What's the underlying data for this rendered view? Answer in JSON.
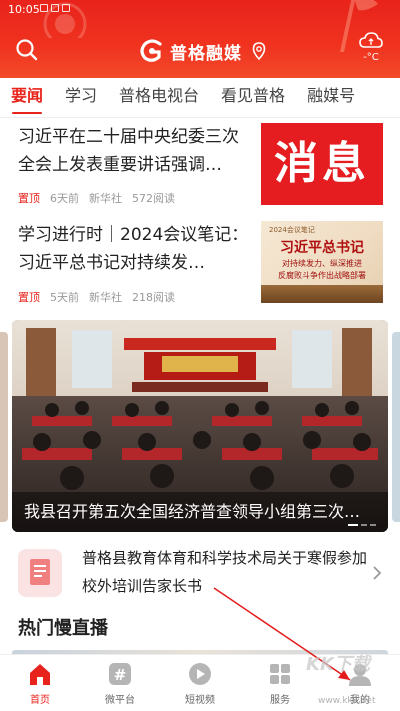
{
  "status_bar": {
    "time": "10:05"
  },
  "header": {
    "brand": "普格融媒",
    "temperature": "-°C"
  },
  "tabs": [
    {
      "label": "要闻",
      "active": true
    },
    {
      "label": "学习"
    },
    {
      "label": "普格电视台"
    },
    {
      "label": "看见普格"
    },
    {
      "label": "融媒号"
    }
  ],
  "news": [
    {
      "title": "习近平在二十届中央纪委三次全会上发表重要讲话强调…",
      "pin": "置顶",
      "time": "6天前",
      "source": "新华社",
      "reads": "572阅读",
      "thumb_text": "消息"
    },
    {
      "title": "学习进行时｜2024会议笔记：习近平总书记对持续发…",
      "pin": "置顶",
      "time": "5天前",
      "source": "新华社",
      "reads": "218阅读",
      "thumb_label": "2024会议笔记",
      "thumb_title": "习近平总书记",
      "thumb_line1": "对持续发力、纵深推进",
      "thumb_line2": "反腐败斗争作出战略部署"
    }
  ],
  "banner": {
    "caption": "我县召开第五次全国经济普查领导小组第三次…"
  },
  "notice": {
    "title": "普格县教育体育和科学技术局关于寒假参加校外培训告家长书"
  },
  "section": {
    "title": "热门慢直播"
  },
  "tabbar": [
    {
      "label": "首页",
      "icon": "home-icon",
      "active": true
    },
    {
      "label": "微平台",
      "icon": "hash-icon"
    },
    {
      "label": "短视频",
      "icon": "play-icon"
    },
    {
      "label": "服务",
      "icon": "grid-icon"
    },
    {
      "label": "我的",
      "icon": "user-icon"
    }
  ],
  "watermark": {
    "text": "KK下载",
    "url": "www.kkx.net"
  },
  "colors": {
    "brand_red": "#e8231b"
  }
}
